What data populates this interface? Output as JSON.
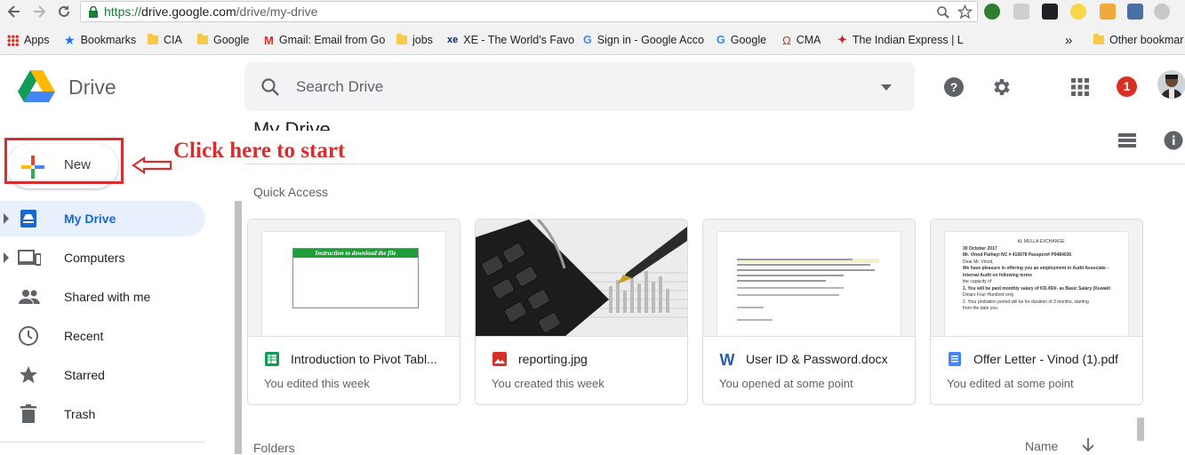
{
  "browser": {
    "url_scheme": "https://",
    "url_host": "drive.google.com",
    "url_path": "/drive/my-drive",
    "bookmarks": [
      {
        "label": "Apps"
      },
      {
        "label": "Bookmarks"
      },
      {
        "label": "CIA"
      },
      {
        "label": "Google"
      },
      {
        "label": "Gmail: Email from Go"
      },
      {
        "label": "jobs"
      },
      {
        "label": "XE - The World's Favo"
      },
      {
        "label": "Sign in - Google Acco"
      },
      {
        "label": "Google"
      },
      {
        "label": "CMA"
      },
      {
        "label": "The Indian Express | L"
      }
    ],
    "more_label": "»",
    "other_bookmarks": "Other bookmar"
  },
  "app": {
    "name": "Drive",
    "search_placeholder": "Search Drive",
    "notification_count": "1",
    "page_title": "My Drive"
  },
  "sidebar": {
    "new_label": "New",
    "items": [
      {
        "label": "My Drive",
        "icon": "my-drive-icon",
        "active": true
      },
      {
        "label": "Computers",
        "icon": "computers-icon"
      },
      {
        "label": "Shared with me",
        "icon": "shared-icon"
      },
      {
        "label": "Recent",
        "icon": "clock-icon"
      },
      {
        "label": "Starred",
        "icon": "star-icon"
      },
      {
        "label": "Trash",
        "icon": "trash-icon"
      }
    ]
  },
  "annotation": {
    "text": "Click here to start",
    "color": "#d32f2f"
  },
  "main": {
    "quick_access_label": "Quick Access",
    "files": [
      {
        "name": "Introduction to Pivot Tabl...",
        "meta": "You edited this week",
        "type": "sheets",
        "thumb_title": "Instruction to download the file"
      },
      {
        "name": "reporting.jpg",
        "meta": "You created this week",
        "type": "image"
      },
      {
        "name": "User ID & Password.docx",
        "meta": "You opened at some point",
        "type": "word"
      },
      {
        "name": "Offer Letter - Vinod (1).pdf",
        "meta": "You edited at some point",
        "type": "docs",
        "thumb_lines": [
          "AL MULLA EXCHANGE",
          "30 October 2017",
          "Mr. Vinod Pathayi NC # 416678 Passport# P9484036",
          "Dear Mr. Vinod,",
          "We have pleasure in offering you an employment in Audit Associate -",
          "Internal Audit on following terms",
          "the capacity of",
          "1. You will be paid monthly salary of KD.450/- as Basic Salary (Kuwaiti",
          "Dinars Four Hundred only.",
          "2. Your probation period will be for duration of 3 months, starting",
          "from the date you"
        ]
      }
    ],
    "folders_label": "Folders",
    "sort_label": "Name"
  },
  "colors": {
    "accent_blue": "#1967d2",
    "active_bg": "#e8f0fe",
    "notification_red": "#d93025"
  }
}
